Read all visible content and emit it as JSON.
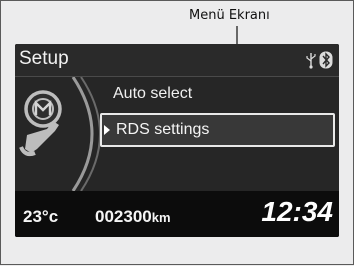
{
  "annotation": {
    "label": "Menü Ekranı"
  },
  "screen": {
    "title": "Setup",
    "status_icons": [
      "usb-icon",
      "bluetooth-icon"
    ],
    "menu": {
      "items": [
        {
          "label": "Auto select",
          "selected": false
        },
        {
          "label": "RDS settings",
          "selected": true
        }
      ]
    },
    "footer": {
      "temperature": "23°c",
      "odometer_value": "002300",
      "odometer_unit": "km",
      "clock": "12:34"
    }
  }
}
